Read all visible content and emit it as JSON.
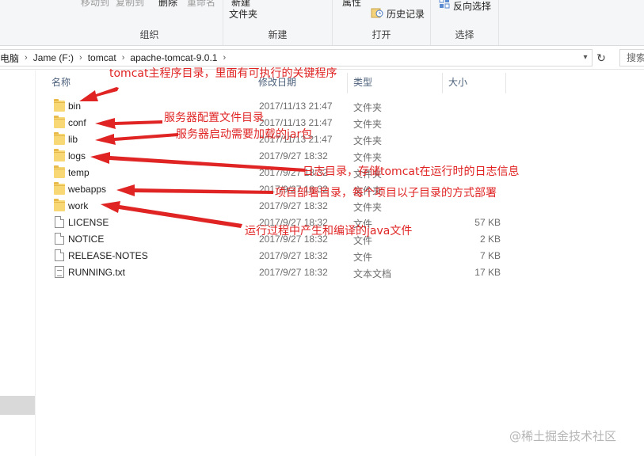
{
  "ribbon": {
    "organize": {
      "label": "组织",
      "move_to": "移动到",
      "copy_to": "复制到",
      "delete": "删除",
      "rename": "重命名"
    },
    "new": {
      "label": "新建",
      "new_item": "新建",
      "folder": "文件夹"
    },
    "open": {
      "label": "打开",
      "properties": "属性",
      "history": "历史记录"
    },
    "select": {
      "label": "选择",
      "invert_selection": "反向选择"
    }
  },
  "address_bar": {
    "crumbs": [
      "电脑",
      "Jame (F:)",
      "tomcat",
      "apache-tomcat-9.0.1"
    ],
    "search_placeholder": "搜索"
  },
  "columns": {
    "name": "名称",
    "date_modified": "修改日期",
    "type": "类型",
    "size": "大小"
  },
  "files": [
    {
      "name": "bin",
      "date": "2017/11/13 21:47",
      "type": "文件夹",
      "size": "",
      "kind": "folder"
    },
    {
      "name": "conf",
      "date": "2017/11/13 21:47",
      "type": "文件夹",
      "size": "",
      "kind": "folder"
    },
    {
      "name": "lib",
      "date": "2017/11/13 21:47",
      "type": "文件夹",
      "size": "",
      "kind": "folder"
    },
    {
      "name": "logs",
      "date": "2017/9/27 18:32",
      "type": "文件夹",
      "size": "",
      "kind": "folder"
    },
    {
      "name": "temp",
      "date": "2017/9/27 18:32",
      "type": "文件夹",
      "size": "",
      "kind": "folder"
    },
    {
      "name": "webapps",
      "date": "2017/9/27 18:32",
      "type": "文件夹",
      "size": "",
      "kind": "folder"
    },
    {
      "name": "work",
      "date": "2017/9/27 18:32",
      "type": "文件夹",
      "size": "",
      "kind": "folder"
    },
    {
      "name": "LICENSE",
      "date": "2017/9/27 18:32",
      "type": "文件",
      "size": "57 KB",
      "kind": "file"
    },
    {
      "name": "NOTICE",
      "date": "2017/9/27 18:32",
      "type": "文件",
      "size": "2 KB",
      "kind": "file"
    },
    {
      "name": "RELEASE-NOTES",
      "date": "2017/9/27 18:32",
      "type": "文件",
      "size": "7 KB",
      "kind": "file"
    },
    {
      "name": "RUNNING.txt",
      "date": "2017/9/27 18:32",
      "type": "文本文档",
      "size": "17 KB",
      "kind": "txt"
    }
  ],
  "annotations": {
    "bin": "tomcat主程序目录，里面有可执行的关键程序",
    "conf": "服务器配置文件目录",
    "lib": "服务器启动需要加载的jar包",
    "logs": "日志目录，存储tomcat在运行时的日志信息",
    "webapps": "项目部署目录，每个项目以子目录的方式部署",
    "work": "运行过程中产生和编译的java文件"
  },
  "colors": {
    "annotation": "#e02424",
    "folder": "#f8d775"
  },
  "watermark": "@稀土掘金技术社区"
}
